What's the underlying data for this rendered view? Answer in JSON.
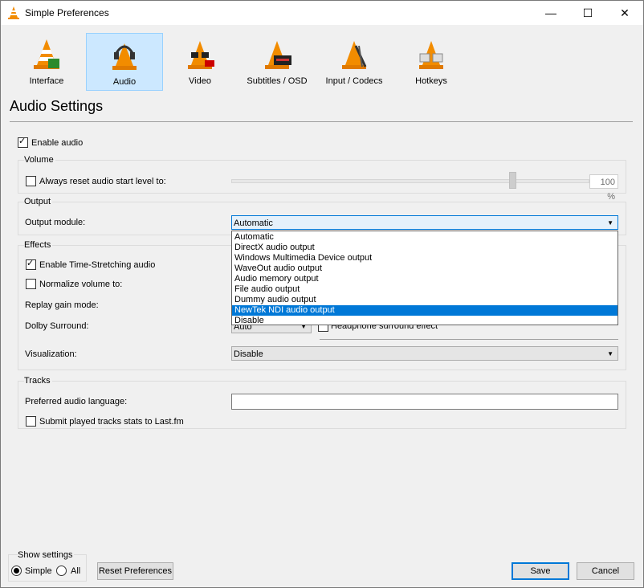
{
  "window": {
    "title": "Simple Preferences",
    "min": "—",
    "max": "☐",
    "close": "✕"
  },
  "toolbar": [
    {
      "label": "Interface"
    },
    {
      "label": "Audio"
    },
    {
      "label": "Video"
    },
    {
      "label": "Subtitles / OSD"
    },
    {
      "label": "Input / Codecs"
    },
    {
      "label": "Hotkeys"
    }
  ],
  "page_title": "Audio Settings",
  "enable_audio": {
    "label": "Enable audio",
    "checked": true
  },
  "volume": {
    "group_title": "Volume",
    "reset_label": "Always reset audio start level to:",
    "reset_checked": false,
    "level": "100 %"
  },
  "output": {
    "group_title": "Output",
    "module_label": "Output module:",
    "module_value": "Automatic",
    "options": [
      "Automatic",
      "DirectX audio output",
      "Windows Multimedia Device output",
      "WaveOut audio output",
      "Audio memory output",
      "File audio output",
      "Dummy audio output",
      "NewTek NDI audio output",
      "Disable"
    ],
    "highlighted_index": 7
  },
  "effects": {
    "group_title": "Effects",
    "time_stretch_label": "Enable Time-Stretching audio",
    "time_stretch_checked": true,
    "normalize_label": "Normalize volume to:",
    "normalize_checked": false,
    "replay_gain_label": "Replay gain mode:",
    "dolby_label": "Dolby Surround:",
    "dolby_value": "Auto",
    "headphone_label": "Headphone surround effect",
    "visualization_label": "Visualization:",
    "visualization_value": "Disable"
  },
  "tracks": {
    "group_title": "Tracks",
    "language_label": "Preferred audio language:",
    "language_value": "",
    "lastfm_label": "Submit played tracks stats to Last.fm",
    "lastfm_checked": false
  },
  "show_settings": {
    "title": "Show settings",
    "simple_label": "Simple",
    "all_label": "All",
    "selected": "Simple"
  },
  "buttons": {
    "reset": "Reset Preferences",
    "save": "Save",
    "cancel": "Cancel"
  },
  "colors": {
    "selection": "#0078d7",
    "toolbar_selected": "#cce8ff"
  }
}
